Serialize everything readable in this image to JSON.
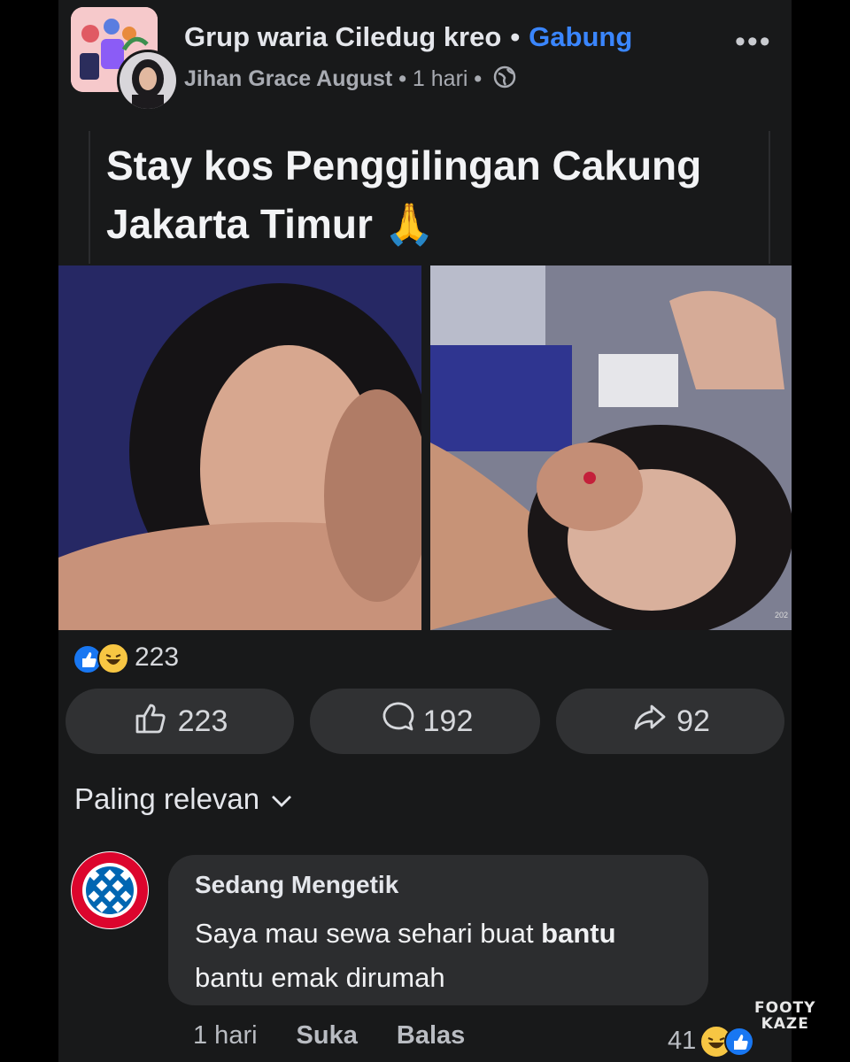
{
  "header": {
    "group_name": "Grup waria Ciledug kreo",
    "join_label": "Gabung",
    "author": "Jihan Grace August",
    "time": "1 hari",
    "more_icon": "more-horizontal-icon",
    "privacy_icon": "globe-icon"
  },
  "post": {
    "text": "Stay kos Penggilingan Cakung Jakarta Timur 🙏",
    "photo_right_mark": "202"
  },
  "reactions": {
    "count": "223",
    "icons": [
      "like-icon",
      "haha-icon"
    ]
  },
  "actions": {
    "like_count": "223",
    "comment_count": "192",
    "share_count": "92"
  },
  "sort": {
    "label": "Paling relevan"
  },
  "comment": {
    "author": "Sedang Mengetik",
    "text_part1": "Saya mau sewa sehari buat ",
    "text_bold": "bantu",
    "text_part2": "bantu emak dirumah",
    "time": "1 hari",
    "like_label": "Suka",
    "reply_label": "Balas",
    "reaction_count": "41",
    "avatar_text": "FC BAYERN MÜNCHEN"
  },
  "watermark": {
    "line1": "FOOTY",
    "line2": "KAZE"
  },
  "colors": {
    "background": "#18191a",
    "accent": "#3a86ff",
    "button": "#303133",
    "bubble": "#2c2d2f"
  }
}
